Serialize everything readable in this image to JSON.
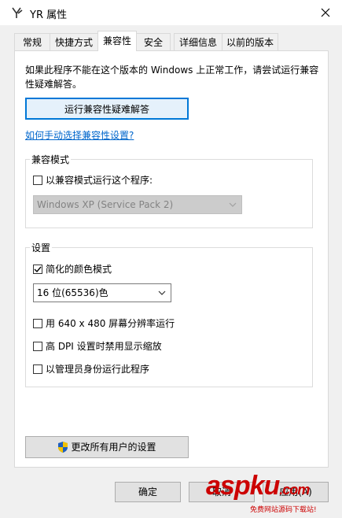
{
  "window": {
    "title": "YR 属性"
  },
  "tabs": [
    {
      "label": "常规"
    },
    {
      "label": "快捷方式"
    },
    {
      "label": "兼容性"
    },
    {
      "label": "安全"
    },
    {
      "label": "详细信息"
    },
    {
      "label": "以前的版本"
    }
  ],
  "compat": {
    "intro": "如果此程序不能在这个版本的 Windows 上正常工作，请尝试运行兼容性疑难解答。",
    "troubleshoot_label": "运行兼容性疑难解答",
    "manual_link": "如何手动选择兼容性设置?",
    "mode_group_label": "兼容模式",
    "mode_checkbox_label": "以兼容模式运行这个程序:",
    "mode_select_value": "Windows XP (Service Pack 2)",
    "settings_group_label": "设置",
    "reduced_color_label": "简化的颜色模式",
    "color_select_value": "16 位(65536)色",
    "res_640_label": "用 640 x 480 屏幕分辨率运行",
    "high_dpi_label": "高 DPI 设置时禁用显示缩放",
    "admin_label": "以管理员身份运行此程序",
    "all_users_label": "更改所有用户的设置"
  },
  "footer": {
    "ok_label": "确定",
    "cancel_label": "取消",
    "apply_label": "应用(A)"
  },
  "watermark": {
    "brand": "aspku",
    "suffix": ".com",
    "tagline": "免费网站源码下载站!"
  },
  "colors": {
    "focus": "#0078d7",
    "link": "#0066cc",
    "watermark": "#cc0000"
  }
}
